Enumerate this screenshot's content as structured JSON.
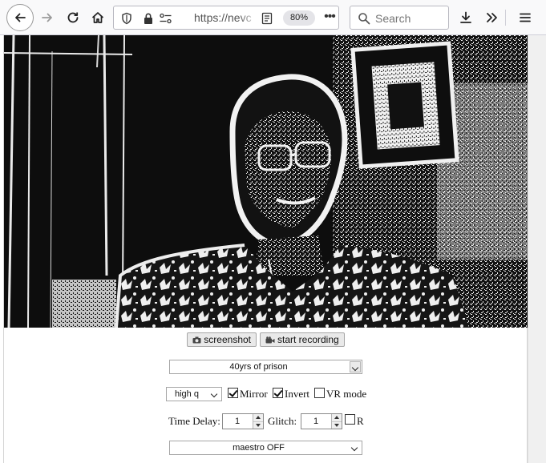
{
  "toolbar": {
    "url_text": "https://nevc",
    "zoom": "80%",
    "more": "•••",
    "search_placeholder": "Search"
  },
  "controls": {
    "screenshot_label": "screenshot",
    "record_label": "start recording",
    "effect_select": "40yrs of prison",
    "quality_select": "high q",
    "mirror_label": "Mirror",
    "mirror_checked": true,
    "invert_label": "Invert",
    "invert_checked": true,
    "vr_label": "VR mode",
    "vr_checked": false,
    "time_delay_label": "Time Delay:",
    "time_delay_value": "1",
    "glitch_label": "Glitch:",
    "glitch_value": "1",
    "r_label": "R",
    "r_checked": false,
    "maestro_select": "maestro OFF"
  }
}
